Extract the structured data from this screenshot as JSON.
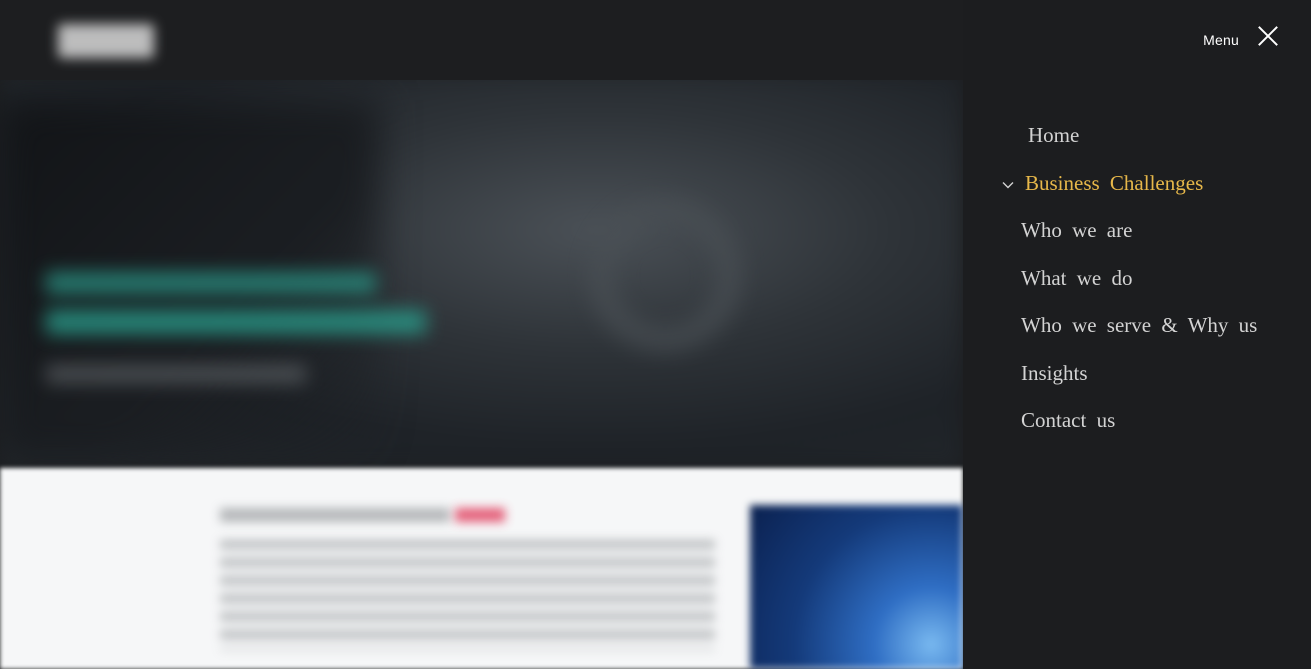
{
  "menu": {
    "label": "Menu",
    "items": [
      {
        "label": "Home"
      },
      {
        "label": "Business Challenges",
        "active": true
      },
      {
        "label": "Who we are"
      },
      {
        "label": "What we do"
      },
      {
        "label": "Who we serve & Why us"
      },
      {
        "label": "Insights"
      },
      {
        "label": "Contact us"
      }
    ]
  },
  "colors": {
    "panel_bg": "#1c1d1f",
    "item_text": "#d3d3d3",
    "active_text": "#e7b84a"
  },
  "icons": {
    "close": "close-icon",
    "expand": "chevron-down-icon"
  }
}
